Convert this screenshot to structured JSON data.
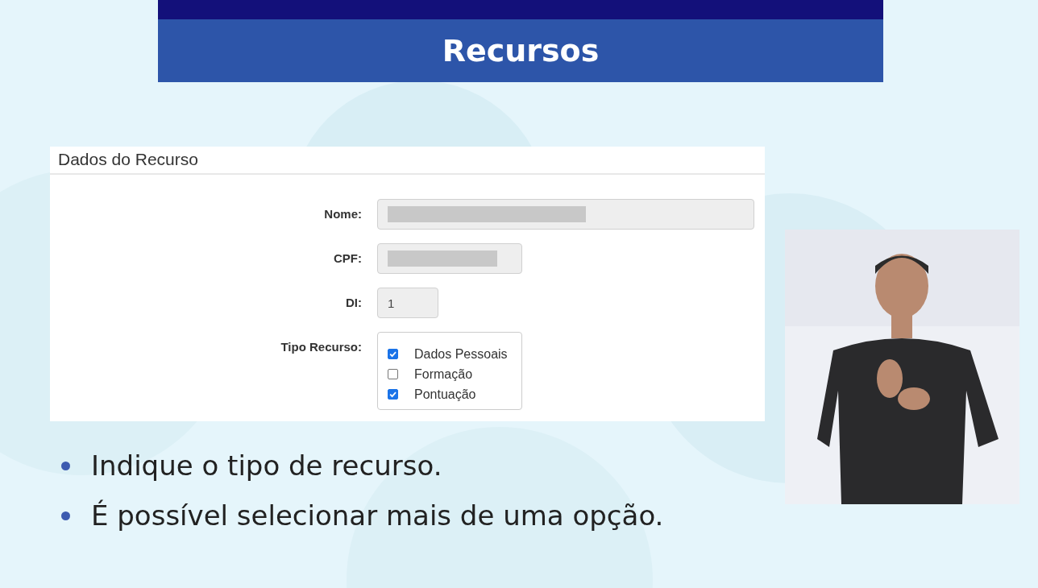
{
  "slide": {
    "title": "Recursos"
  },
  "form": {
    "heading": "Dados do Recurso",
    "fields": [
      {
        "label": "Nome:",
        "kind": "redacted"
      },
      {
        "label": "CPF:",
        "kind": "redacted"
      },
      {
        "label": "DI:",
        "kind": "text",
        "value": "1"
      },
      {
        "label": "Tipo Recurso:",
        "kind": "checklist",
        "options": [
          {
            "label": "Dados Pessoais",
            "checked": true
          },
          {
            "label": "Formação",
            "checked": false
          },
          {
            "label": "Pontuação",
            "checked": true
          }
        ]
      }
    ]
  },
  "bullets": [
    "Indique o tipo de recurso.",
    "É possível selecionar mais de uma opção."
  ],
  "interpreter": {
    "kind": "picture"
  }
}
